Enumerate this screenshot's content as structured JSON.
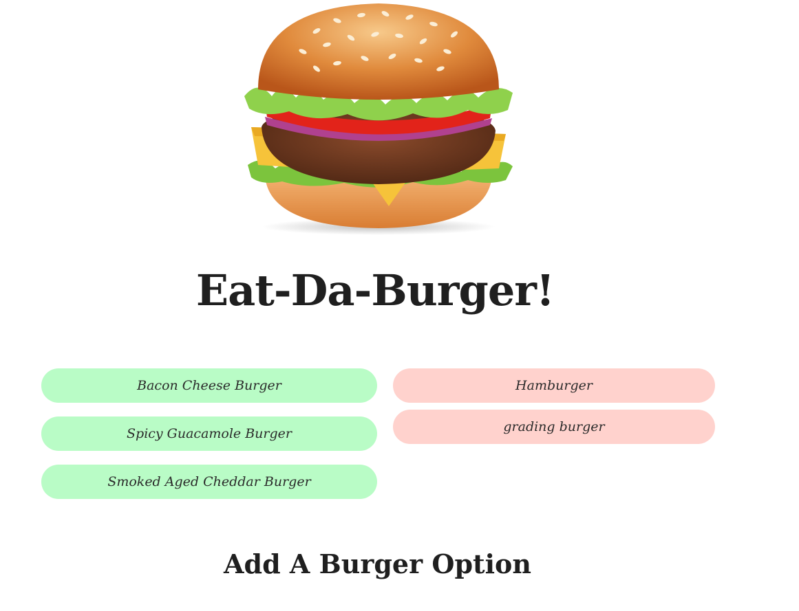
{
  "hero": {
    "image_name": "hamburger-illustration"
  },
  "header": {
    "title": "Eat-Da-Burger!"
  },
  "available_burgers": [
    {
      "label": "Bacon Cheese Burger"
    },
    {
      "label": "Spicy Guacamole Burger"
    },
    {
      "label": "Smoked Aged Cheddar Burger"
    }
  ],
  "devoured_burgers": [
    {
      "label": "Hamburger"
    },
    {
      "label": "grading burger"
    }
  ],
  "add_section": {
    "heading": "Add A Burger Option"
  },
  "colors": {
    "available": "#b9fcc6",
    "devoured": "#ffd2cd",
    "text": "#222222"
  }
}
